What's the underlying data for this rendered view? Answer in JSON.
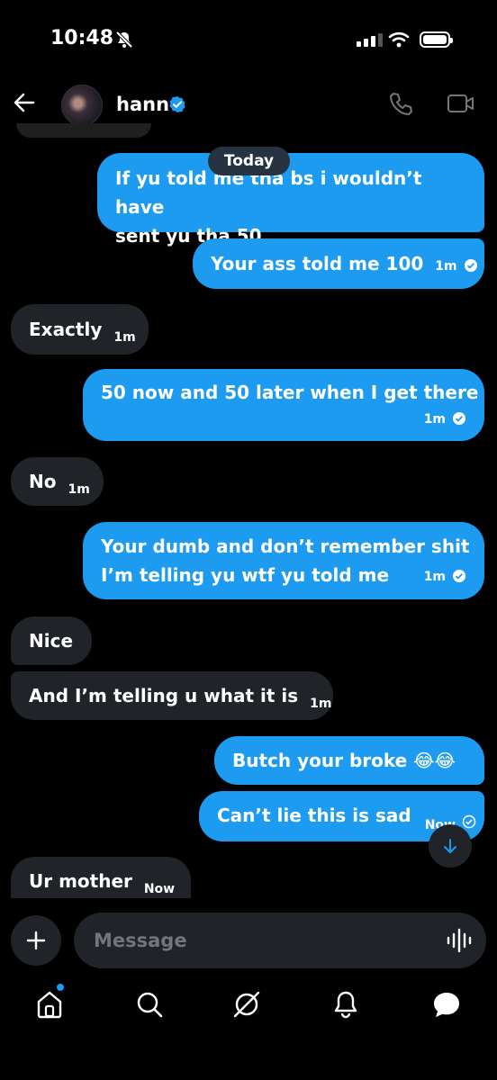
{
  "status_bar": {
    "time": "10:48"
  },
  "header": {
    "contact_name": "hann"
  },
  "date_divider": "Today",
  "messages": [
    {
      "direction": "out",
      "lines": [
        "If yu told me tha bs i wouldn’t have",
        "sent yu tha 50"
      ],
      "time": ""
    },
    {
      "direction": "out",
      "text": "Your ass told me 100",
      "time": "1m"
    },
    {
      "direction": "in",
      "text": "Exactly",
      "time": "1m"
    },
    {
      "direction": "out",
      "text": "50 now and 50 later when I get there",
      "time": "1m"
    },
    {
      "direction": "in",
      "text": "No",
      "time": "1m"
    },
    {
      "direction": "out",
      "lines": [
        "Your dumb and don’t remember shit",
        "I’m telling yu wtf yu told me"
      ],
      "time": "1m"
    },
    {
      "direction": "in",
      "text": "Nice",
      "time": ""
    },
    {
      "direction": "in",
      "text": "And I’m telling u what it is",
      "time": "1m"
    },
    {
      "direction": "out",
      "text": "Butch your broke 😂😂",
      "time": ""
    },
    {
      "direction": "out",
      "text": "Can’t lie this is sad",
      "time": "Now"
    },
    {
      "direction": "in",
      "text": "Ur mother",
      "time": "Now"
    }
  ],
  "composer": {
    "placeholder": "Message"
  },
  "colors": {
    "accent": "#1d9bf0",
    "incoming_bubble": "#202327",
    "background": "#000000",
    "muted": "#71767b"
  },
  "nav_icons": [
    "home-icon",
    "search-icon",
    "grok-icon",
    "notifications-icon",
    "messages-icon"
  ]
}
